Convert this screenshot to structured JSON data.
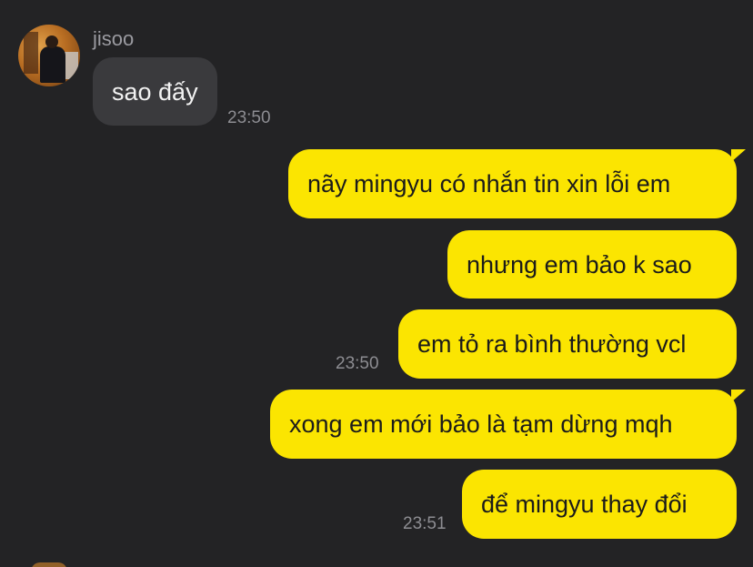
{
  "contact": {
    "name": "jisoo"
  },
  "messages": [
    {
      "text": "sao đấy",
      "direction": "incoming"
    },
    {
      "text": "nãy mingyu có nhắn tin xin lỗi em",
      "direction": "outgoing"
    },
    {
      "text": "nhưng em bảo k sao",
      "direction": "outgoing"
    },
    {
      "text": "em tỏ ra bình thường vcl",
      "direction": "outgoing"
    },
    {
      "text": "xong em mới bảo là tạm dừng mqh",
      "direction": "outgoing"
    },
    {
      "text": "để mingyu thay đổi",
      "direction": "outgoing"
    }
  ],
  "timestamps": {
    "t1": "23:50",
    "t2": "23:50",
    "t3": "23:51"
  },
  "colors": {
    "background": "#232325",
    "incoming_bubble": "#3a3a3d",
    "outgoing_bubble": "#fbe501",
    "timestamp": "#8d8d92"
  }
}
